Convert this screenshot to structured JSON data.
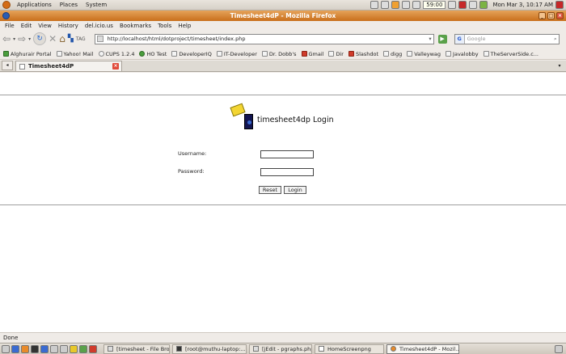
{
  "top_panel": {
    "menus": [
      "Applications",
      "Places",
      "System"
    ],
    "battery": "59:00",
    "clock": "Mon Mar  3, 10:17 AM"
  },
  "window": {
    "title": "Timesheet4dP - Mozilla Firefox"
  },
  "menubar": [
    "File",
    "Edit",
    "View",
    "History",
    "del.icio.us",
    "Bookmarks",
    "Tools",
    "Help"
  ],
  "navbar": {
    "url": "http://localhost/html/dotproject/timesheet/index.php",
    "search_placeholder": "Google",
    "tag_label": "TAG"
  },
  "bookmarks": [
    {
      "label": "Alghurair Portal",
      "icon": "green-square-icon"
    },
    {
      "label": "Yahoo! Mail",
      "icon": "page-icon"
    },
    {
      "label": "CUPS 1.2.4",
      "icon": "cups-icon"
    },
    {
      "label": "HO Test",
      "icon": "green-leaf-icon"
    },
    {
      "label": "DeveloperIQ",
      "icon": "page-icon"
    },
    {
      "label": "IT-Developer",
      "icon": "page-icon"
    },
    {
      "label": "Dr. Dobb's",
      "icon": "page-icon"
    },
    {
      "label": "Gmail",
      "icon": "gmail-icon"
    },
    {
      "label": "Dir",
      "icon": "page-icon"
    },
    {
      "label": "Slashdot",
      "icon": "slashdot-icon"
    },
    {
      "label": "digg",
      "icon": "page-icon"
    },
    {
      "label": "Valleywag",
      "icon": "page-icon"
    },
    {
      "label": "Javalobby",
      "icon": "page-icon"
    },
    {
      "label": "TheServerSide.c...",
      "icon": "page-icon"
    }
  ],
  "tab": {
    "label": "Timesheet4dP"
  },
  "login": {
    "title": "timesheet4dp Login",
    "username_label": "Username:",
    "password_label": "Password:",
    "username_value": "",
    "password_value": "",
    "reset_label": "Reset",
    "login_label": "Login"
  },
  "status": {
    "text": "Done"
  },
  "taskbar": {
    "tasks": [
      "[timesheet - File Bro...",
      "[root@muthu-laptop:...",
      "[jEdit - pgraphs.php]",
      "HomeScreenpng",
      "Timesheet4dP - Mozil..."
    ]
  }
}
